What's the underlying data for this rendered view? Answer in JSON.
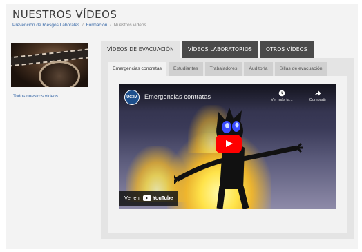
{
  "page": {
    "title": "NUESTROS VÍDEOS",
    "breadcrumb": [
      {
        "label": "Prevención de Riesgos Laborales",
        "link": true
      },
      {
        "label": "Formación",
        "link": true
      },
      {
        "label": "Nuestros vídeos",
        "link": false
      }
    ]
  },
  "sidebar": {
    "link_label": "Todos nuestros vídeos"
  },
  "main_tabs": [
    {
      "label": "VÍDEOS DE EVACUACIÓN",
      "active": true
    },
    {
      "label": "VÍDEOS LABORATORIOS",
      "active": false
    },
    {
      "label": "OTROS VÍDEOS",
      "active": false
    }
  ],
  "sub_tabs": [
    {
      "label": "Emergencias concretas",
      "active": true
    },
    {
      "label": "Estudiantes",
      "active": false
    },
    {
      "label": "Trabajadores",
      "active": false
    },
    {
      "label": "Auditoría",
      "active": false
    },
    {
      "label": "Sillas de evacuación",
      "active": false
    }
  ],
  "video": {
    "channel_badge": "UC3M",
    "title": "Emergencias contratas",
    "watch_later_label": "Ver más ta...",
    "share_label": "Compartir",
    "watch_on_label": "Ver en",
    "platform_label": "YouTube"
  },
  "colors": {
    "tab_dark": "#4a4a4a",
    "tab_active": "#e4e4e4",
    "link": "#3a6aa8",
    "play_red": "#ff0000",
    "fire_yellow": "#ffe34a"
  }
}
